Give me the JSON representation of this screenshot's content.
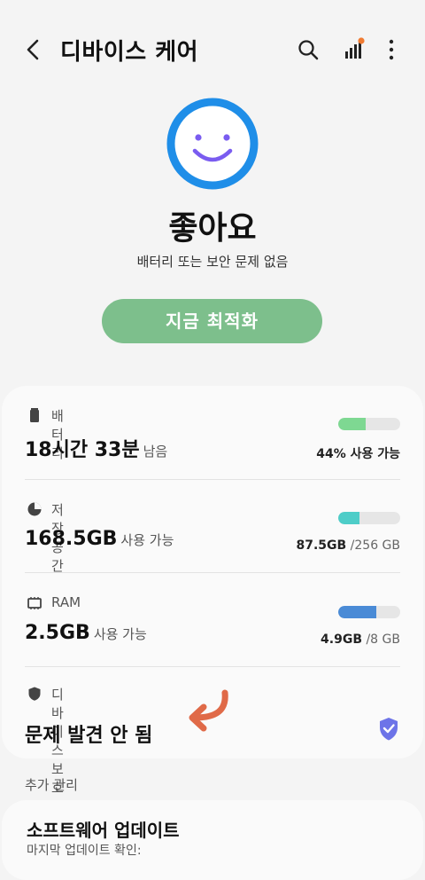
{
  "header": {
    "title": "디바이스 케어"
  },
  "status": {
    "label": "좋아요",
    "description": "배터리 또는 보안 문제 없음",
    "accent": "#1f8ee8",
    "face": "#7a5cf0"
  },
  "optimize": {
    "label": "지금 최적화",
    "color": "#7dbf8c"
  },
  "battery": {
    "label": "배터리",
    "value": "18시간 33분",
    "unit": "남음",
    "side_value": "44% 사용 가능",
    "level": 0.44,
    "color": "#7ed892"
  },
  "storage": {
    "label": "저장공간",
    "value": "168.5GB",
    "unit": "사용 가능",
    "used": "87.5GB",
    "total": "/256 GB",
    "level": 0.34,
    "color": "#4ecdc8"
  },
  "ram": {
    "label": "RAM",
    "value": "2.5GB",
    "unit": "사용 가능",
    "used": "4.9GB",
    "total": "/8 GB",
    "level": 0.61,
    "color": "#4a8bd6"
  },
  "protection": {
    "label": "디바이스 보호",
    "value": "문제 발견 안 됨",
    "shield_color": "#6d74e8",
    "arrow_color": "#e06a48"
  },
  "additional": {
    "section_label": "추가 관리",
    "software_update_title": "소프트웨어 업데이트",
    "software_update_sub": "마지막 업데이트 확인:"
  }
}
